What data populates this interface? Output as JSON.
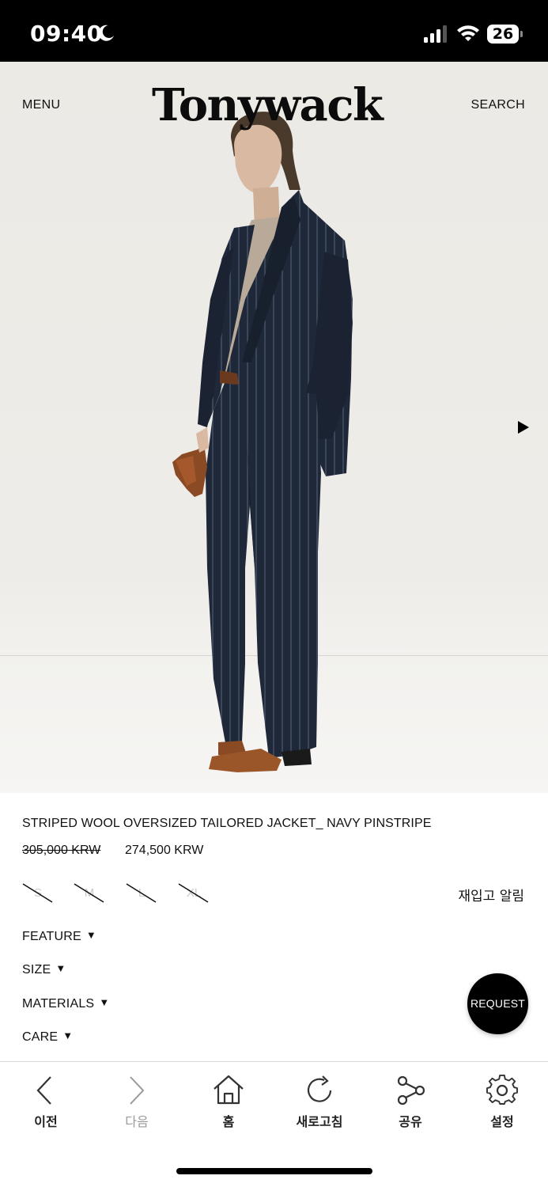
{
  "status_bar": {
    "time": "09:40",
    "battery": "26",
    "icons": [
      "moon-icon",
      "cellular-signal-icon",
      "wifi-icon",
      "battery-icon"
    ]
  },
  "header": {
    "menu_label": "MENU",
    "logo": "Tonywack",
    "search_label": "SEARCH"
  },
  "product": {
    "name": "STRIPED WOOL OVERSIZED TAILORED JACKET_ NAVY PINSTRIPE",
    "original_price": "305,000 KRW",
    "sale_price": "274,500 KRW",
    "sizes": [
      {
        "label": "S",
        "available": false
      },
      {
        "label": "M",
        "available": false
      },
      {
        "label": "L",
        "available": false
      },
      {
        "label": "XL",
        "available": false
      }
    ],
    "restock_label": "재입고 알림",
    "sections": [
      {
        "label": "FEATURE"
      },
      {
        "label": "SIZE"
      },
      {
        "label": "MATERIALS"
      },
      {
        "label": "CARE"
      }
    ],
    "caret": "▼",
    "request_label": "REQUEST"
  },
  "toolbar": {
    "items": [
      {
        "label": "이전",
        "icon": "back-icon",
        "enabled": true
      },
      {
        "label": "다음",
        "icon": "forward-icon",
        "enabled": false
      },
      {
        "label": "홈",
        "icon": "home-icon",
        "enabled": true
      },
      {
        "label": "새로고침",
        "icon": "refresh-icon",
        "enabled": true
      },
      {
        "label": "공유",
        "icon": "share-icon",
        "enabled": true
      },
      {
        "label": "설정",
        "icon": "gear-icon",
        "enabled": true
      }
    ]
  },
  "colors": {
    "status_bar_bg": "#000000",
    "hero_bg": "#ECEAE5",
    "suit_navy": "#1E2838",
    "accent_black": "#000000"
  }
}
